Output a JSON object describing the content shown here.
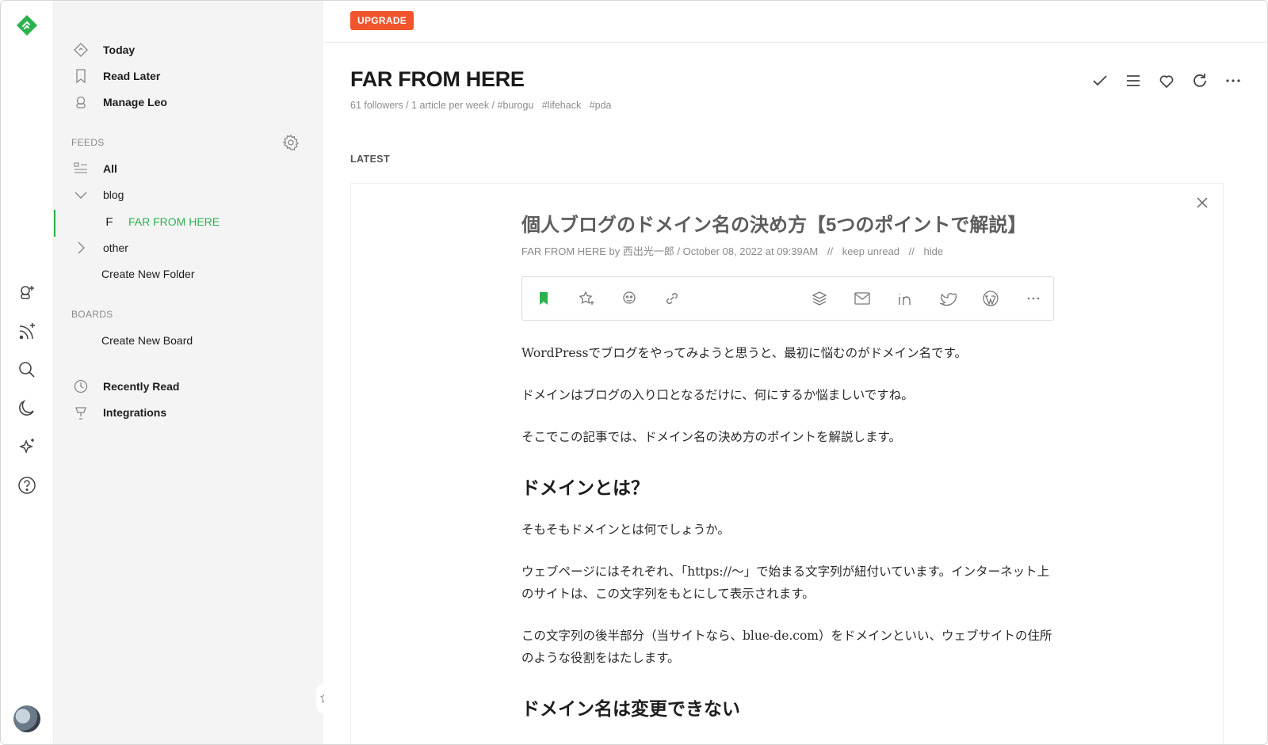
{
  "sidebar": {
    "top_items": [
      {
        "label": "Today",
        "icon": "today-icon"
      },
      {
        "label": "Read Later",
        "icon": "bookmark-icon"
      },
      {
        "label": "Manage Leo",
        "icon": "leo-icon"
      }
    ],
    "feeds_title": "FEEDS",
    "feeds": {
      "all": "All",
      "blog": "blog",
      "active_feed_letter": "F",
      "active_feed": "FAR FROM HERE",
      "other": "other",
      "create_folder": "Create New Folder"
    },
    "boards_title": "BOARDS",
    "create_board": "Create New Board",
    "recently_read": "Recently Read",
    "integrations": "Integrations"
  },
  "topbar": {
    "upgrade_label": "UPGRADE"
  },
  "feed_header": {
    "title": "FAR FROM HERE",
    "stats": "61 followers / 1 article per week / #burogu",
    "tags": [
      "#lifehack",
      "#pda"
    ]
  },
  "latest_label": "LATEST",
  "article": {
    "title": "個人ブログのドメイン名の決め方【5つのポイントで解説】",
    "meta_source": "FAR FROM HERE by 西出光一郎 / October 08, 2022 at 09:39AM",
    "meta_sep": "//",
    "keep_unread": "keep unread",
    "hide": "hide",
    "paragraphs_1": [
      "WordPressでブログをやってみようと思うと、最初に悩むのがドメイン名です。",
      "ドメインはブログの入り口となるだけに、何にするか悩ましいですね。",
      "そこでこの記事では、ドメイン名の決め方のポイントを解説します。"
    ],
    "heading_1": "ドメインとは？",
    "paragraphs_2": [
      "そもそもドメインとは何でしょうか。",
      "ウェブページにはそれぞれ、「https://〜」で始まる文字列が紐付いています。インターネット上のサイトは、この文字列をもとにして表示されます。",
      "この文字列の後半部分（当サイトなら、blue-de.com）をドメインといい、ウェブサイトの住所のような役割をはたします。"
    ],
    "heading_2": "ドメイン名は変更できない"
  },
  "colors": {
    "accent_green": "#2bb24c",
    "upgrade_orange": "#f2542d"
  }
}
